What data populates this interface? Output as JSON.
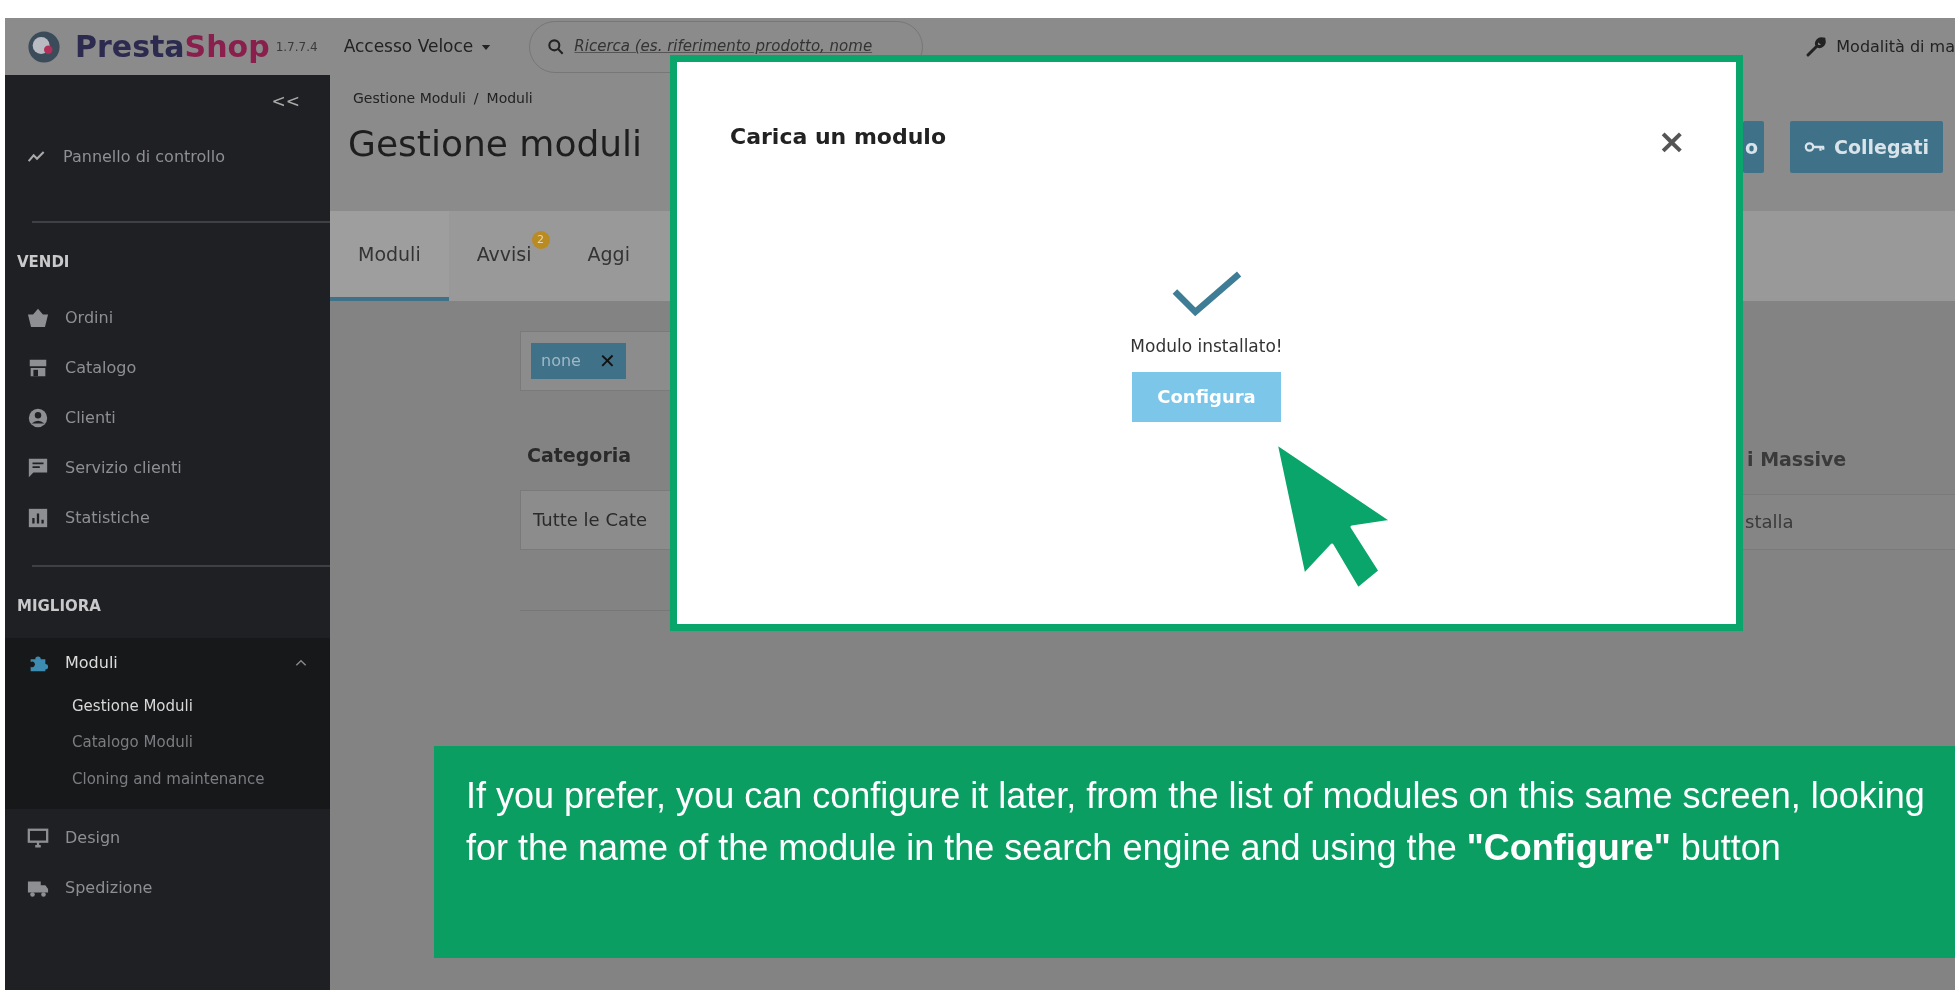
{
  "topbar": {
    "logo_part_1": "Presta",
    "logo_part_2": "Shop",
    "version": "1.7.7.4",
    "quick_access": "Accesso Veloce",
    "search_placeholder": "Ricerca (es. riferimento prodotto, nome",
    "maintenance": "Modalità di ma"
  },
  "sidebar": {
    "collapse": "<<",
    "dashboard": "Pannello di controllo",
    "sections": [
      {
        "title": "VENDI",
        "items": [
          {
            "label": "Ordini",
            "expanded": false
          },
          {
            "label": "Catalogo",
            "expanded": false
          },
          {
            "label": "Clienti",
            "expanded": false
          },
          {
            "label": "Servizio clienti",
            "expanded": false
          },
          {
            "label": "Statistiche",
            "expanded": false
          }
        ]
      },
      {
        "title": "MIGLIORA",
        "items": [
          {
            "label": "Moduli",
            "expanded": true,
            "children": [
              {
                "label": "Gestione Moduli",
                "selected": true
              },
              {
                "label": "Catalogo Moduli",
                "selected": false
              },
              {
                "label": "Cloning and maintenance",
                "selected": false
              }
            ]
          },
          {
            "label": "Design",
            "expanded": false
          },
          {
            "label": "Spedizione",
            "expanded": false
          }
        ]
      }
    ]
  },
  "page": {
    "breadcrumb": [
      {
        "label": "Gestione Moduli",
        "separator": "/"
      },
      {
        "label": "Moduli"
      }
    ],
    "title": "Gestione moduli",
    "header_buttons": [
      {
        "label": "o"
      },
      {
        "label": "Collegati"
      }
    ],
    "tabs": [
      {
        "label": "Moduli",
        "selected": true
      },
      {
        "label": "Avvisi",
        "selected": false,
        "badge": "2"
      },
      {
        "label": "Aggi",
        "selected": false
      }
    ],
    "filter_chip": "none",
    "filter_chip_remove": "✕",
    "category_label": "Categoria",
    "category_value": "Tutte le Cate",
    "bulk_label": "i Massive",
    "bulk_value": "stalla"
  },
  "modal": {
    "title": "Carica un modulo",
    "close": "×",
    "message": "Modulo installato!",
    "button": "Configura"
  },
  "caption": "If you prefer, you can configure it later, from the list of modules on this same screen, looking for the name of the module in the search engine and using the **\"Configure\"** button"
}
